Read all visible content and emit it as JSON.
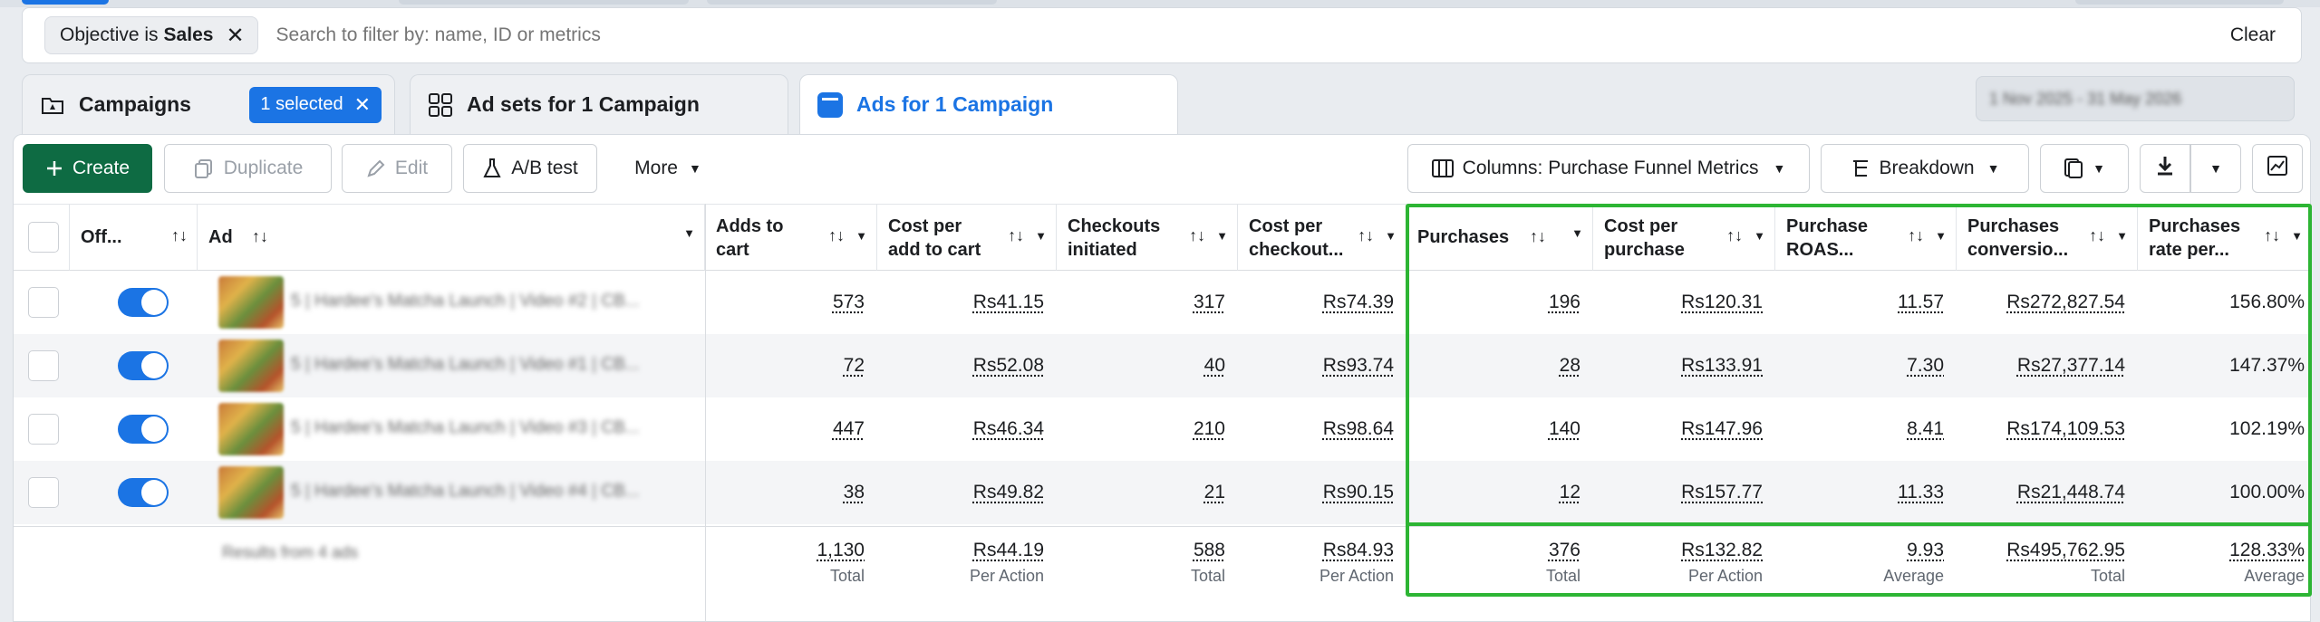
{
  "filter": {
    "chip_prefix": "Objective is",
    "chip_value": "Sales",
    "placeholder": "Search to filter by: name, ID or metrics",
    "clear_label": "Clear"
  },
  "tabs": {
    "campaigns": "Campaigns",
    "selected_badge": "1 selected",
    "adsets": "Ad sets for 1 Campaign",
    "ads": "Ads for 1 Campaign"
  },
  "date_range": "1 Nov 2025 - 31 May 2026",
  "toolbar": {
    "create": "Create",
    "duplicate": "Duplicate",
    "edit": "Edit",
    "ab_test": "A/B test",
    "more": "More",
    "columns": "Columns: Purchase Funnel Metrics",
    "breakdown": "Breakdown"
  },
  "columns": {
    "off": "Off...",
    "ad": "Ad",
    "adds_to_cart": "Adds to\ncart",
    "cost_per_add": "Cost per\nadd to cart",
    "checkouts": "Checkouts\ninitiated",
    "cost_per_checkout": "Cost per\ncheckout...",
    "purchases": "Purchases",
    "cost_per_purchase": "Cost per\npurchase",
    "roas": "Purchase\nROAS...",
    "conversion": "Purchases\nconversio...",
    "rate": "Purchases\nrate per..."
  },
  "rows": [
    {
      "name": "5 | Hardee's Matcha Launch | Video #2 | CB...",
      "adds": "573",
      "cpa": "Rs41.15",
      "checkouts": "317",
      "cpc": "Rs74.39",
      "purchases": "196",
      "cpp": "Rs120.31",
      "roas": "11.57",
      "conv": "Rs272,827.54",
      "rate": "156.80%"
    },
    {
      "name": "5 | Hardee's Matcha Launch | Video #1 | CB...",
      "adds": "72",
      "cpa": "Rs52.08",
      "checkouts": "40",
      "cpc": "Rs93.74",
      "purchases": "28",
      "cpp": "Rs133.91",
      "roas": "7.30",
      "conv": "Rs27,377.14",
      "rate": "147.37%"
    },
    {
      "name": "5 | Hardee's Matcha Launch | Video #3 | CB...",
      "adds": "447",
      "cpa": "Rs46.34",
      "checkouts": "210",
      "cpc": "Rs98.64",
      "purchases": "140",
      "cpp": "Rs147.96",
      "roas": "8.41",
      "conv": "Rs174,109.53",
      "rate": "102.19%"
    },
    {
      "name": "5 | Hardee's Matcha Launch | Video #4 | CB...",
      "adds": "38",
      "cpa": "Rs49.82",
      "checkouts": "21",
      "cpc": "Rs90.15",
      "purchases": "12",
      "cpp": "Rs157.77",
      "roas": "11.33",
      "conv": "Rs21,448.74",
      "rate": "100.00%"
    }
  ],
  "totals": {
    "label": "Results from 4 ads",
    "adds": {
      "value": "1,130",
      "sub": "Total"
    },
    "cpa": {
      "value": "Rs44.19",
      "sub": "Per Action"
    },
    "checkouts": {
      "value": "588",
      "sub": "Total"
    },
    "cpc": {
      "value": "Rs84.93",
      "sub": "Per Action"
    },
    "purchases": {
      "value": "376",
      "sub": "Total"
    },
    "cpp": {
      "value": "Rs132.82",
      "sub": "Per Action"
    },
    "roas": {
      "value": "9.93",
      "sub": "Average"
    },
    "conv": {
      "value": "Rs495,762.95",
      "sub": "Total"
    },
    "rate": {
      "value": "128.33%",
      "sub": "Average"
    }
  },
  "colors": {
    "create_green": "#0e6b43",
    "accent_blue": "#1b74e4",
    "highlight_green": "#2db534"
  }
}
